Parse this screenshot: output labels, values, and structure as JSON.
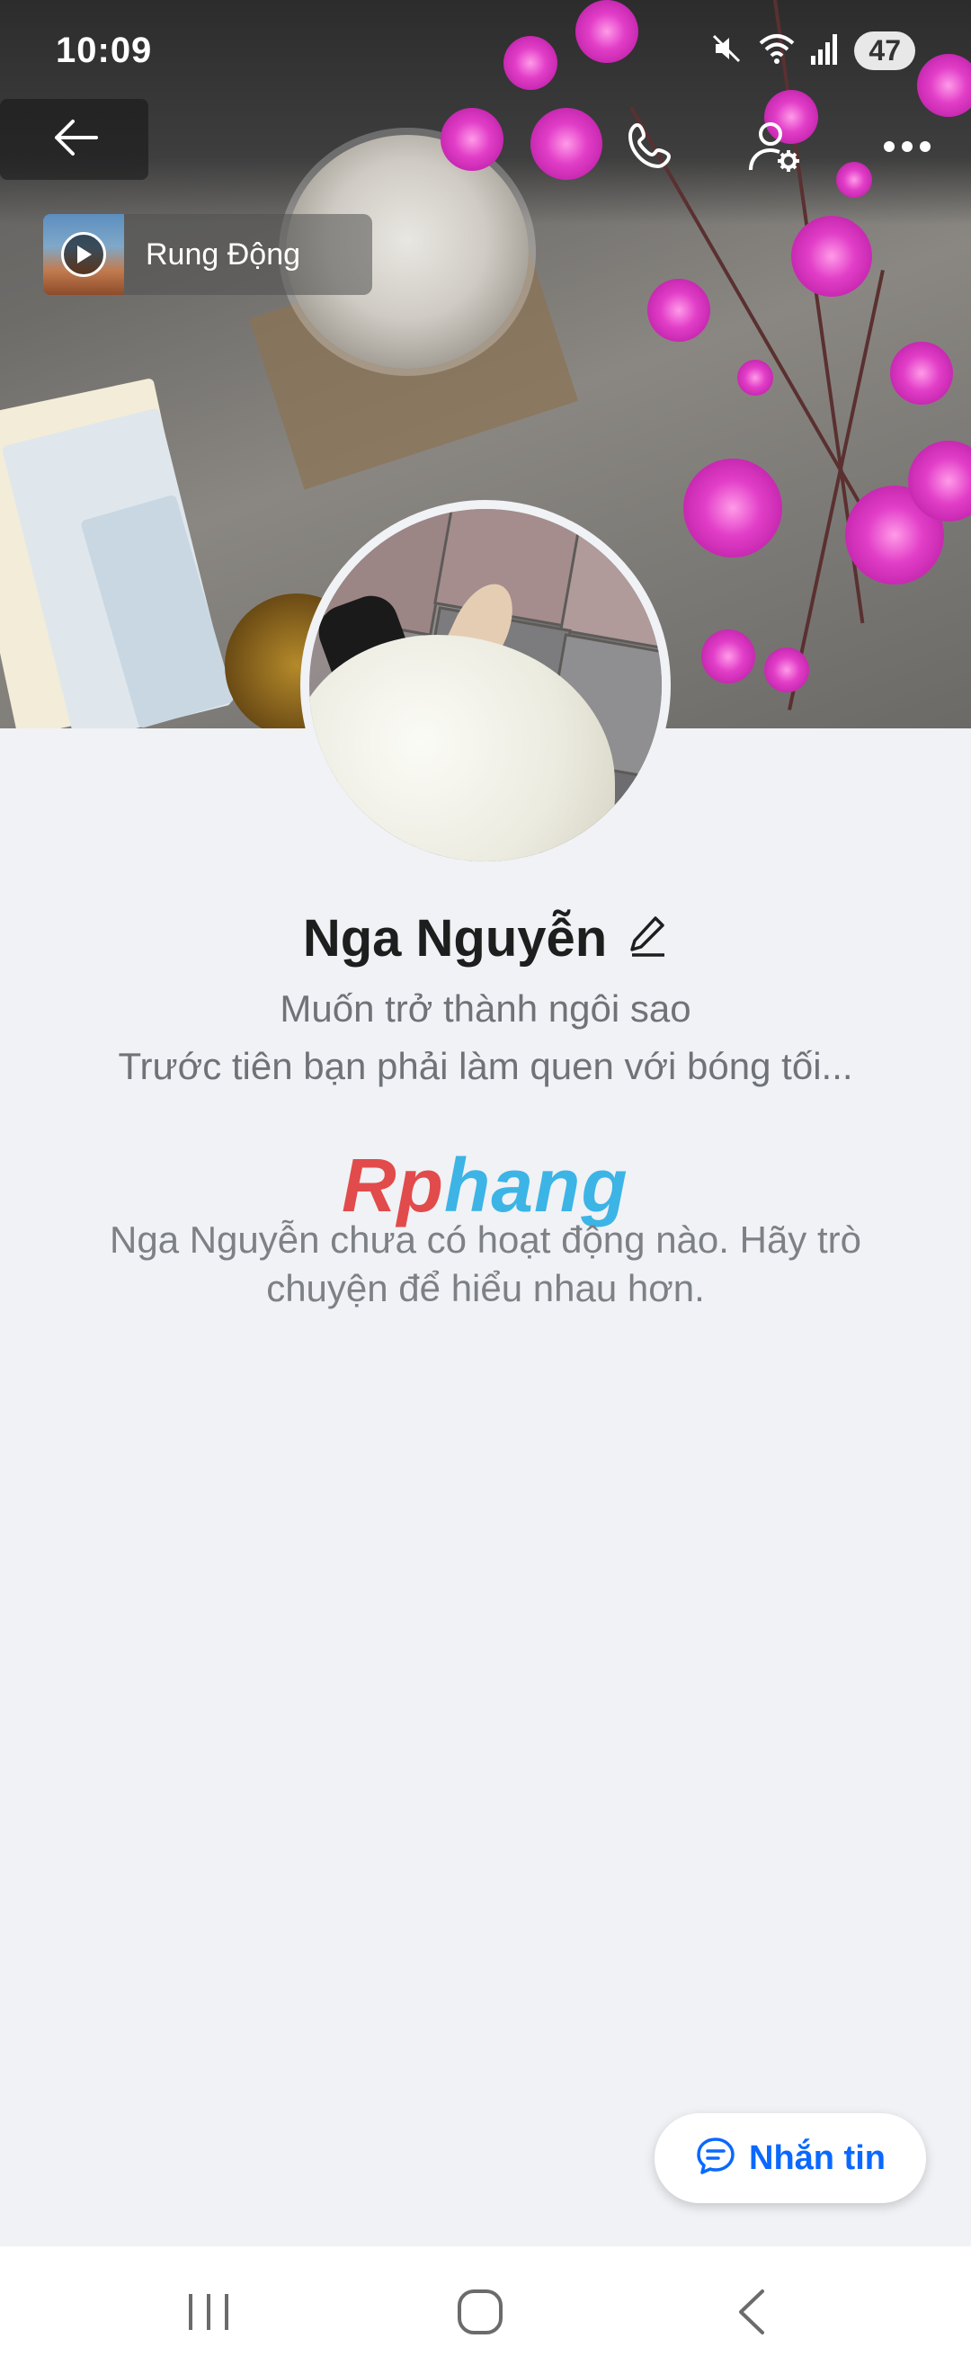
{
  "status_bar": {
    "time": "10:09",
    "battery": "47",
    "icons": [
      "mute-icon",
      "wifi-icon",
      "signal-icon"
    ]
  },
  "top_bar": {
    "icons": [
      "back-arrow-icon",
      "phone-icon",
      "user-settings-icon",
      "more-icon"
    ]
  },
  "music": {
    "title": "Rung Động",
    "icon": "play-icon"
  },
  "profile": {
    "name": "Nga Nguyễn",
    "edit_icon": "pencil-icon",
    "bio_line_1": "Muốn trở thành ngôi sao",
    "bio_line_2": "Trước tiên bạn phải làm quen với bóng tối..."
  },
  "watermark": {
    "part1": "Rp",
    "part2": "hang"
  },
  "activity": {
    "empty_text": "Nga Nguyễn chưa có hoạt động nào. Hãy trò chuyện để hiểu nhau hơn."
  },
  "message_button": {
    "label": "Nhắn tin",
    "icon": "chat-bubble-icon"
  },
  "nav_bar": {
    "icons": [
      "recent-apps-icon",
      "home-icon",
      "back-icon"
    ]
  },
  "colors": {
    "accent": "#0a68ff",
    "background": "#f0f2f5",
    "secondary_text": "#6f7378"
  }
}
